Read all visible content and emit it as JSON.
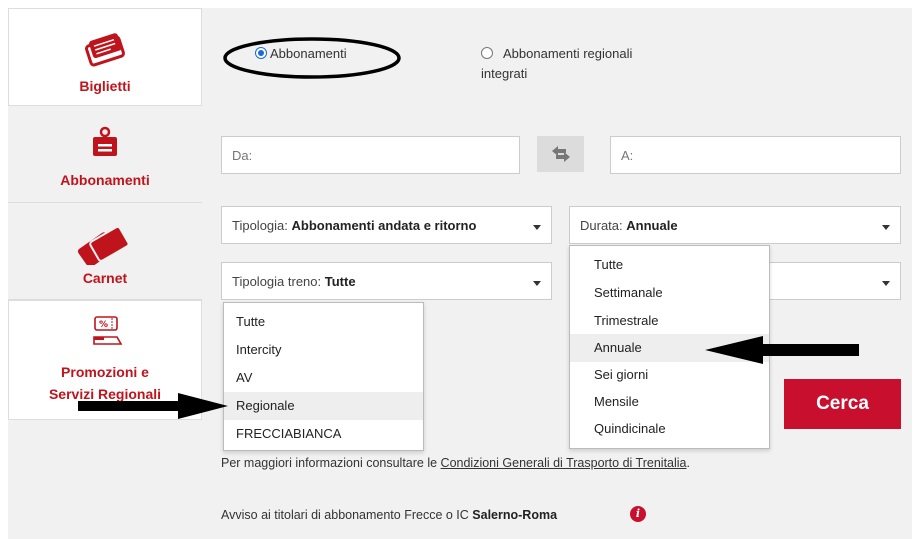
{
  "sidebar": {
    "tabs": [
      {
        "label": "Biglietti",
        "icon": "ticket-icon"
      },
      {
        "label": "Abbonamenti",
        "icon": "badge-icon"
      },
      {
        "label": "Carnet",
        "icon": "tickets-stack-icon"
      },
      {
        "label_line1": "Promozioni e",
        "label_line2": "Servizi Regionali",
        "icon": "discount-ticket-icon"
      }
    ]
  },
  "radios": {
    "option1": "Abbonamenti",
    "option2_line1": "Abbonamenti regionali",
    "option2_line2": "integrati"
  },
  "route": {
    "from_placeholder": "Da:",
    "to_placeholder": "A:"
  },
  "filters": {
    "tipologia_label": "Tipologia:",
    "tipologia_value": "Abbonamenti andata e ritorno",
    "durata_label": "Durata:",
    "durata_value": "Annuale",
    "treno_label": "Tipologia treno:",
    "treno_value": "Tutte"
  },
  "train_dropdown": {
    "options": [
      "Tutte",
      "Intercity",
      "AV",
      "Regionale",
      "FRECCIABIANCA"
    ],
    "highlighted": "Regionale"
  },
  "duration_dropdown": {
    "options": [
      "Tutte",
      "Settimanale",
      "Trimestrale",
      "Annuale",
      "Sei giorni",
      "Mensile",
      "Quindicinale"
    ],
    "highlighted": "Annuale"
  },
  "search_button": "Cerca",
  "info": {
    "prefix": "Per maggiori informazioni consultare le ",
    "link": "Condizioni Generali di Trasporto di Trenitalia",
    "suffix": "."
  },
  "notice": {
    "text": "Avviso ai titolari di abbonamento Frecce o IC ",
    "bold": "Salerno-Roma",
    "icon_glyph": "i"
  },
  "colors": {
    "brand_red": "#c8102e",
    "radio_blue": "#1a6ad8"
  }
}
